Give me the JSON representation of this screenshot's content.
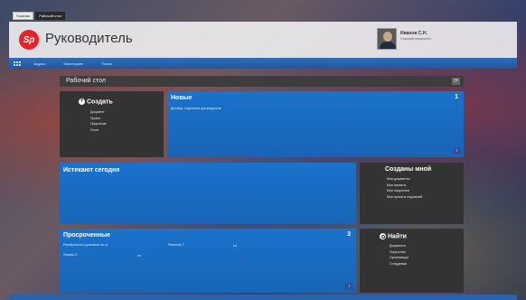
{
  "tabs": [
    "Главная",
    "Рабочий стол"
  ],
  "header": {
    "logo_text": "Sp",
    "app_title": "Руководитель",
    "user_name": "Иванов С.Н.",
    "user_role": "Старший специалист"
  },
  "nav": {
    "items": [
      "Задачи",
      "Мониторинг",
      "Поиск"
    ]
  },
  "page": {
    "title": "Рабочий стол",
    "refresh_icon": "refresh-icon"
  },
  "tiles": {
    "create": {
      "title": "Создать",
      "items": [
        "Документ",
        "Проект",
        "Поручение",
        "Отчет"
      ]
    },
    "new": {
      "title": "Новые",
      "count": "1",
      "items": [
        "Договор: поручение руководителя"
      ]
    },
    "due_today": {
      "title": "Истекают сегодня"
    },
    "created_by_me": {
      "title": "Созданы мной",
      "items": [
        "Мои документы",
        "Мои проекты",
        "Мои поручения",
        "Мои проекты поручений"
      ]
    },
    "overdue": {
      "title": "Просроченные",
      "count": "3",
      "rows": [
        {
          "left": "Разобраться и доложить по ст.",
          "mid": "Решение 7",
          "dots": "•••"
        },
        {
          "left": "Письмо 2",
          "mid": "",
          "dots": "•••"
        }
      ]
    },
    "find": {
      "title": "Найти",
      "items": [
        "Документы",
        "Поручения",
        "Организации",
        "Сотрудники"
      ]
    }
  },
  "colors": {
    "accent_blue": "#1a72cc",
    "nav_blue": "#2f6db7",
    "tile_dark": "#333333",
    "logo_red": "#e8222a"
  }
}
